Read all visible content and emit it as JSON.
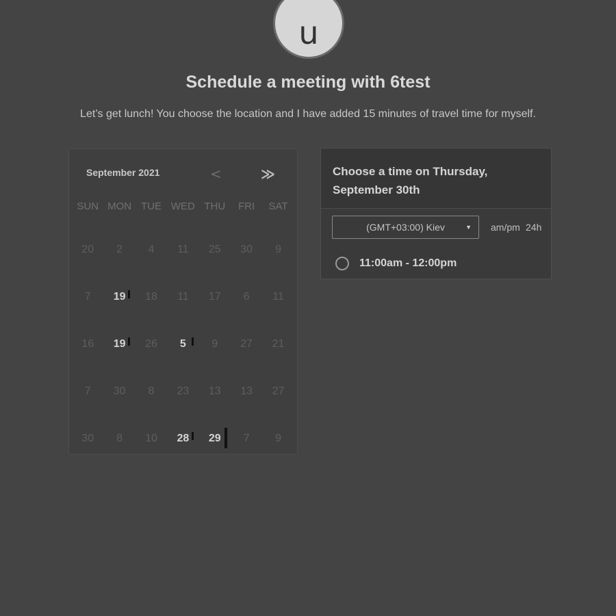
{
  "host": {
    "avatar_letter": "u",
    "title": "Schedule a meeting with 6test",
    "description": "Let’s get lunch! You choose the location and I have added 15 minutes of travel time for myself."
  },
  "calendar": {
    "month_label": "September 2021",
    "prev_icon": "chevron-left-icon",
    "next_icon": "chevron-right-icon",
    "prev_glyph": "<",
    "next_glyph": "≫",
    "weekdays": [
      "SUN",
      "MON",
      "TUE",
      "WED",
      "THU",
      "FRI",
      "SAT"
    ],
    "weeks": [
      [
        {
          "d": "20"
        },
        {
          "d": "2"
        },
        {
          "d": "4"
        },
        {
          "d": "11"
        },
        {
          "d": "25"
        },
        {
          "d": "30"
        },
        {
          "d": "9"
        }
      ],
      [
        {
          "d": "7"
        },
        {
          "d": "19",
          "available": true
        },
        {
          "d": "18"
        },
        {
          "d": "11"
        },
        {
          "d": "17"
        },
        {
          "d": "6"
        },
        {
          "d": "11"
        }
      ],
      [
        {
          "d": "16"
        },
        {
          "d": "19",
          "available": true
        },
        {
          "d": "26"
        },
        {
          "d": "5",
          "available": true
        },
        {
          "d": "9"
        },
        {
          "d": "27"
        },
        {
          "d": "21"
        }
      ],
      [
        {
          "d": "7"
        },
        {
          "d": "30"
        },
        {
          "d": "8"
        },
        {
          "d": "23"
        },
        {
          "d": "13"
        },
        {
          "d": "13"
        },
        {
          "d": "27"
        }
      ],
      [
        {
          "d": "30"
        },
        {
          "d": "8"
        },
        {
          "d": "10"
        },
        {
          "d": "28",
          "available": true
        },
        {
          "d": "29",
          "available": true,
          "selected": true
        },
        {
          "d": "7"
        },
        {
          "d": "9"
        }
      ]
    ]
  },
  "times": {
    "header": "Choose a time on Thursday, September 30th",
    "timezone": "(GMT+03:00) Kiev",
    "format_ampm": "am/pm",
    "format_24h": "24h",
    "slots": [
      {
        "label": "11:00am - 12:00pm"
      }
    ]
  },
  "colors": {
    "background": "#444444",
    "card": "#3f3f3f",
    "text": "#d0d0d0",
    "muted": "#5e5e5e"
  }
}
